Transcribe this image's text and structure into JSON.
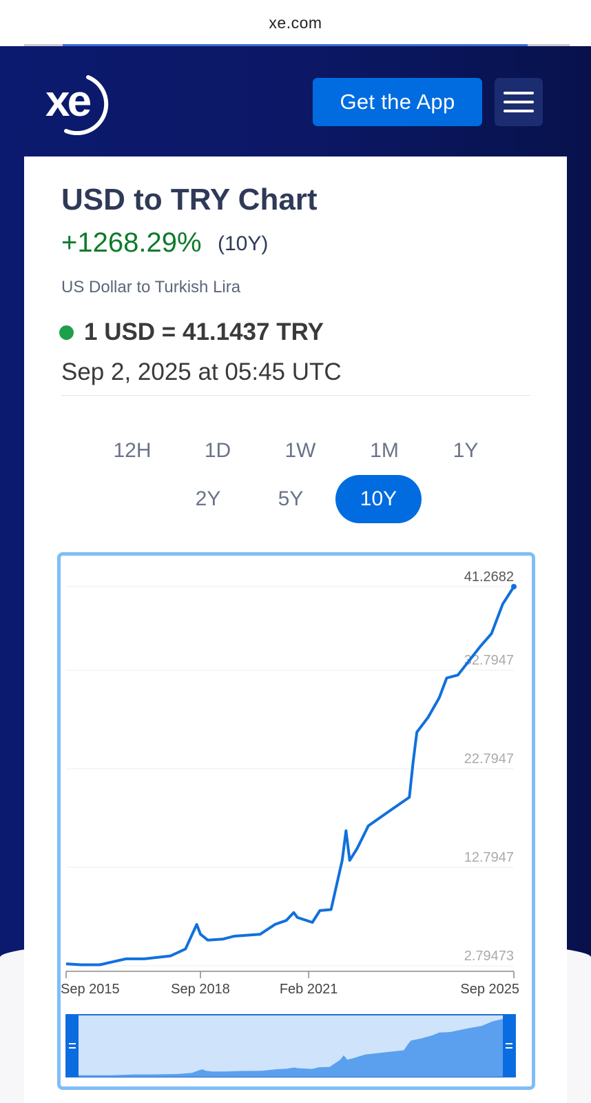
{
  "browser": {
    "url": "xe.com"
  },
  "header": {
    "logo_text": "xe",
    "get_app_label": "Get the App"
  },
  "chart_header": {
    "title": "USD to TRY Chart",
    "change_percent": "+1268.29%",
    "change_period": "(10Y)",
    "subtitle": "US Dollar to Turkish Lira",
    "rate": "1 USD = 41.1437 TRY",
    "timestamp": "Sep 2, 2025 at 05:45 UTC"
  },
  "periods": [
    {
      "label": "12H",
      "active": false
    },
    {
      "label": "1D",
      "active": false
    },
    {
      "label": "1W",
      "active": false
    },
    {
      "label": "1M",
      "active": false
    },
    {
      "label": "1Y",
      "active": false
    },
    {
      "label": "2Y",
      "active": false
    },
    {
      "label": "5Y",
      "active": false
    },
    {
      "label": "10Y",
      "active": true
    }
  ],
  "colors": {
    "accent": "#006ce0",
    "positive": "#0d7a2c",
    "line": "#1170dd",
    "navy": "#0b1a6e"
  },
  "chart_data": {
    "type": "line",
    "title": "",
    "xlabel": "",
    "ylabel": "",
    "series": [
      {
        "x": [
          "2015-09",
          "2016-01",
          "2016-06",
          "2017-01",
          "2017-06",
          "2018-01",
          "2018-05",
          "2018-08",
          "2018-09",
          "2018-11",
          "2019-03",
          "2019-06",
          "2020-01",
          "2020-05",
          "2020-08",
          "2020-10",
          "2020-11",
          "2021-03",
          "2021-05",
          "2021-08",
          "2021-11",
          "2021-12",
          "2022-01",
          "2022-03",
          "2022-06",
          "2022-12",
          "2023-05",
          "2023-06",
          "2023-07",
          "2023-10",
          "2024-01",
          "2024-03",
          "2024-06",
          "2024-12",
          "2025-03",
          "2025-06",
          "2025-09"
        ],
        "y": [
          3.0,
          2.9,
          2.9,
          3.5,
          3.5,
          3.8,
          4.5,
          7.0,
          6.0,
          5.4,
          5.5,
          5.8,
          6.0,
          7.0,
          7.4,
          8.2,
          7.7,
          7.2,
          8.4,
          8.5,
          13.5,
          16.5,
          13.5,
          14.7,
          17.0,
          18.6,
          19.9,
          23.5,
          26.5,
          28.0,
          30.0,
          32.0,
          32.3,
          35.2,
          36.5,
          39.5,
          41.2682
        ]
      }
    ],
    "y_ticks": [
      "41.2682",
      "32.7947",
      "22.7947",
      "12.7947",
      "2.79473"
    ],
    "x_ticks": [
      "Sep 2015",
      "Sep 2018",
      "Feb 2021",
      "Sep 2025"
    ],
    "ylim": [
      2.79473,
      41.2682
    ],
    "grid": true,
    "legend": "none"
  }
}
